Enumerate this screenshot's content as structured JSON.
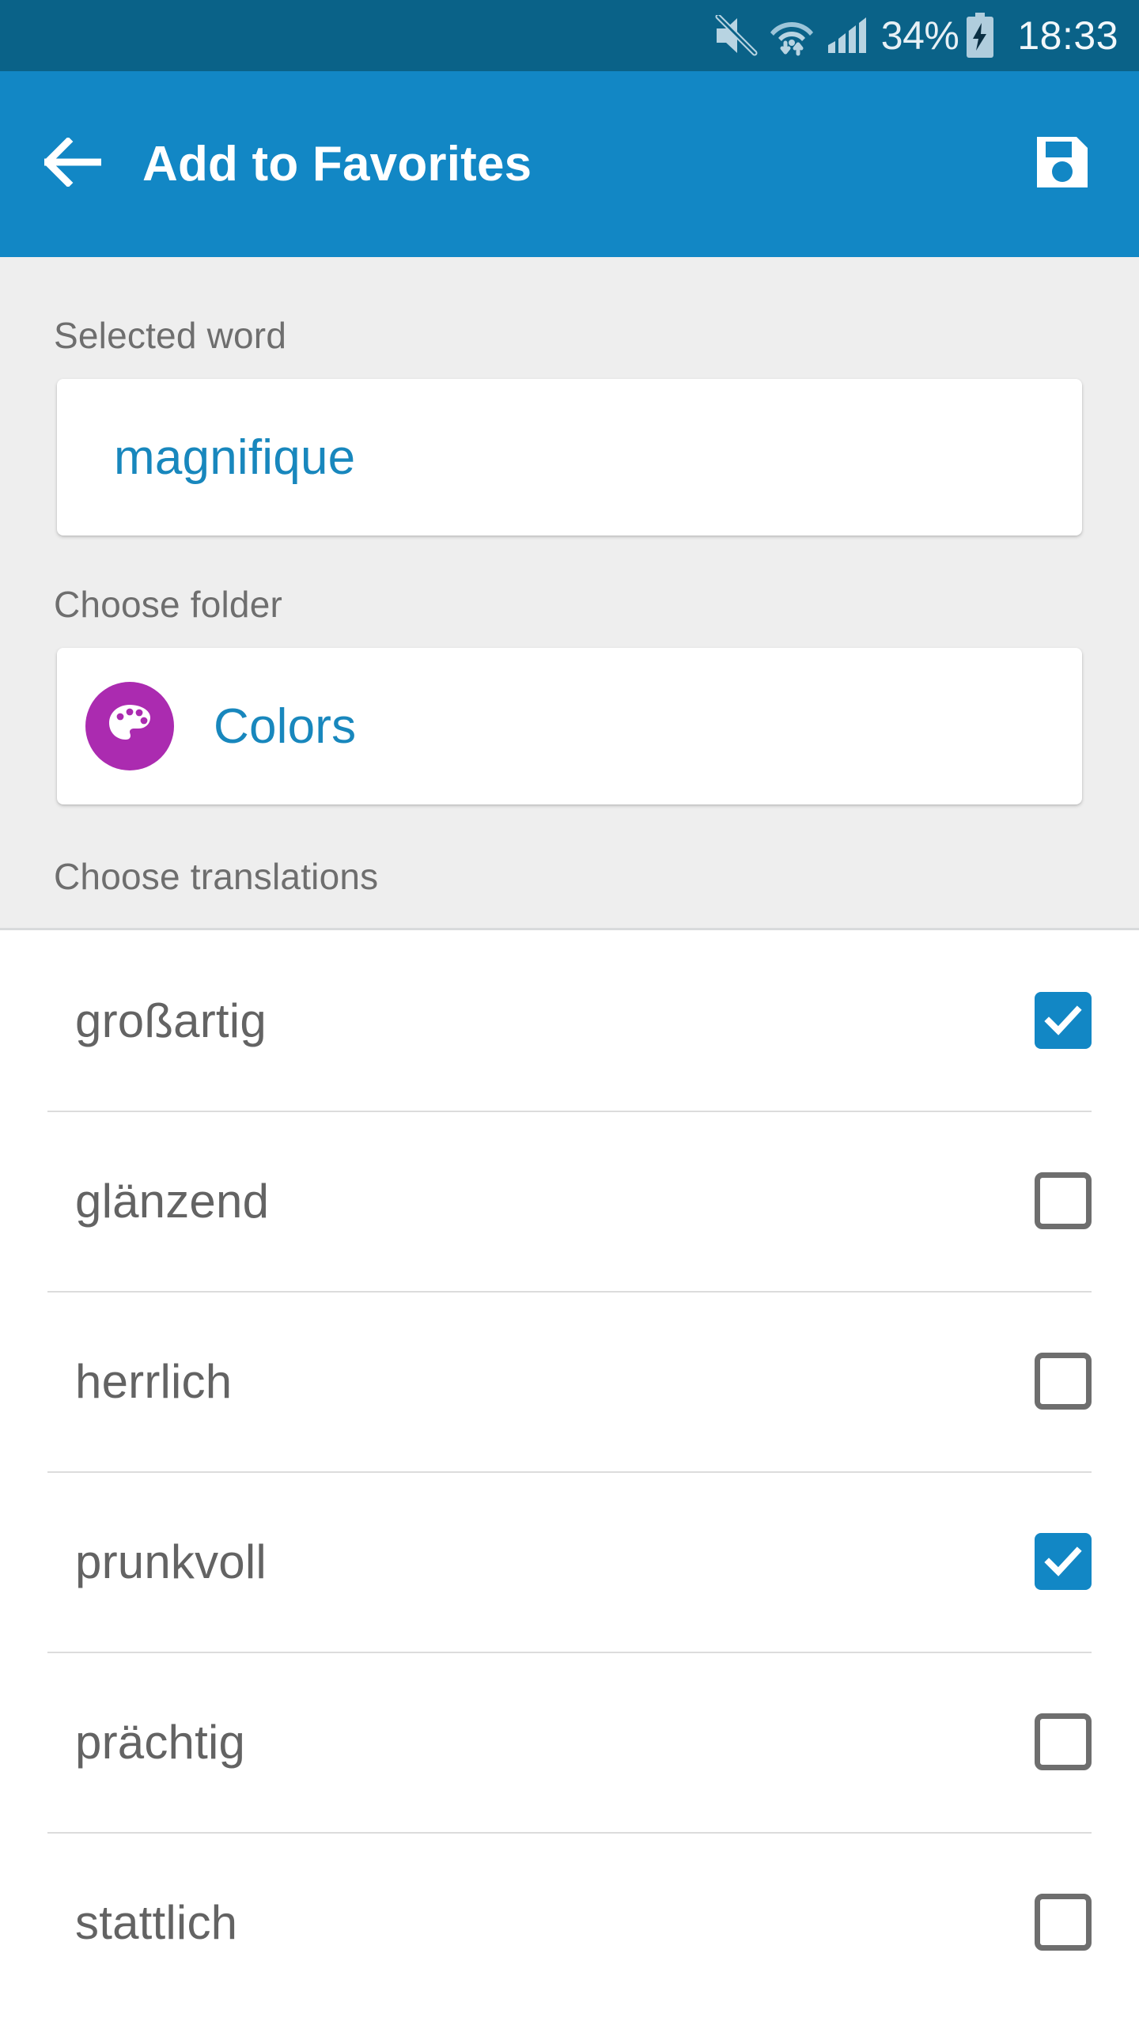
{
  "status_bar": {
    "battery_percent": "34%",
    "time": "18:33",
    "icons": [
      "mute-icon",
      "wifi-icon",
      "signal-icon",
      "battery-charging-icon"
    ],
    "background_color": "#0a6288"
  },
  "app_bar": {
    "title": "Add to Favorites",
    "back_icon": "back-arrow-icon",
    "save_icon": "save-floppy-icon",
    "background_color": "#1287c5"
  },
  "form": {
    "selected_word_label": "Selected word",
    "selected_word_value": "magnifique",
    "choose_folder_label": "Choose folder",
    "folder_name": "Colors",
    "folder_icon": "palette-icon",
    "folder_avatar_color": "#ab2bb0",
    "choose_translations_label": "Choose translations",
    "accent_color": "#1887bd"
  },
  "translations": [
    {
      "text": "großartig",
      "checked": true
    },
    {
      "text": "glänzend",
      "checked": false
    },
    {
      "text": "herrlich",
      "checked": false
    },
    {
      "text": "prunkvoll",
      "checked": true
    },
    {
      "text": "prächtig",
      "checked": false
    },
    {
      "text": "stattlich",
      "checked": false
    }
  ]
}
